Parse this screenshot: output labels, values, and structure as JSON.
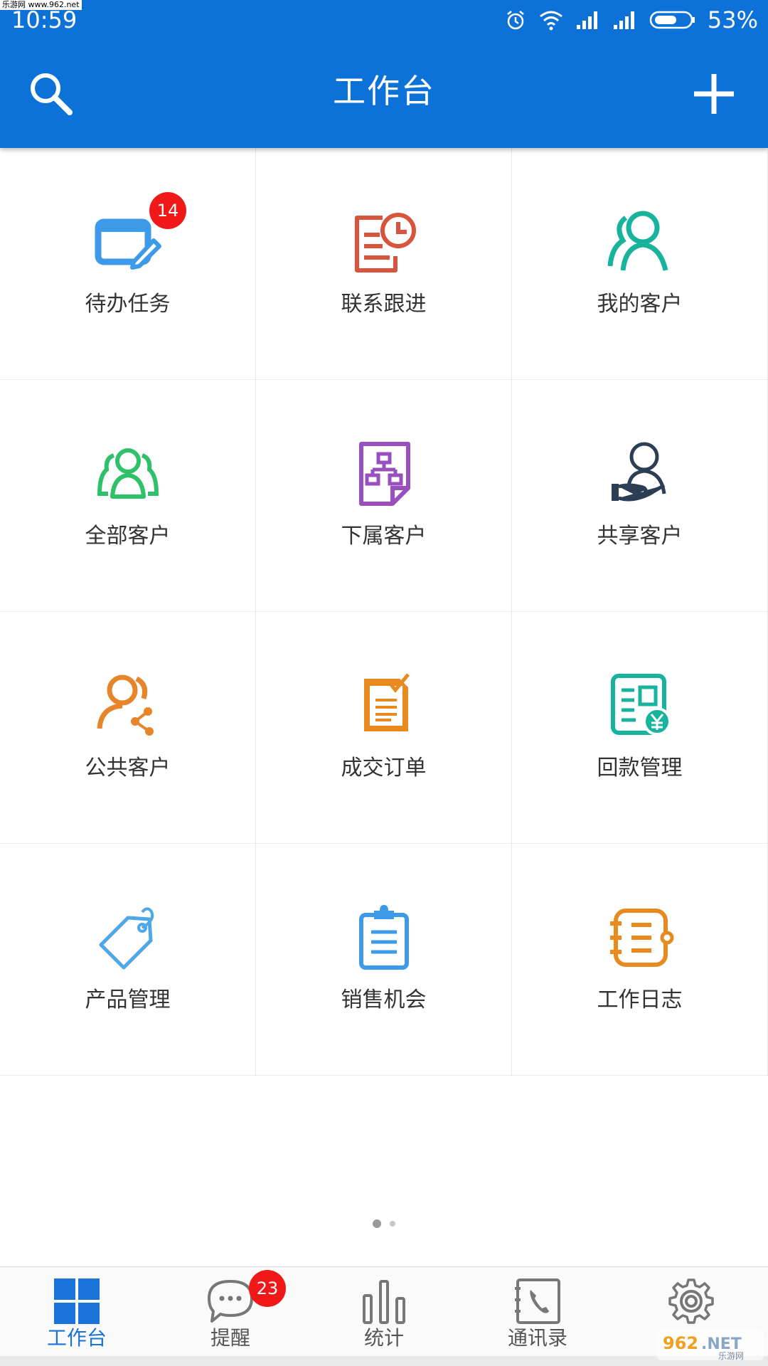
{
  "status_bar": {
    "watermark": "乐游网 www.962.net",
    "time": "10:59",
    "battery": "53%"
  },
  "header": {
    "title": "工作台"
  },
  "grid": [
    {
      "label": "待办任务",
      "badge": "14",
      "icon": "task-edit-icon",
      "color": "#3d9ae8"
    },
    {
      "label": "联系跟进",
      "icon": "followup-clock-icon",
      "color": "#d9543c"
    },
    {
      "label": "我的客户",
      "icon": "my-customer-icon",
      "color": "#17b39c"
    },
    {
      "label": "全部客户",
      "icon": "all-customers-icon",
      "color": "#2fc16a"
    },
    {
      "label": "下属客户",
      "icon": "subordinate-customers-icon",
      "color": "#9a4fbf"
    },
    {
      "label": "共享客户",
      "icon": "shared-customer-icon",
      "color": "#2c3e55"
    },
    {
      "label": "公共客户",
      "icon": "public-customers-icon",
      "color": "#e6852a"
    },
    {
      "label": "成交订单",
      "icon": "order-icon",
      "color": "#e88a1e"
    },
    {
      "label": "回款管理",
      "icon": "payment-icon",
      "color": "#17b39c"
    },
    {
      "label": "产品管理",
      "icon": "product-tag-icon",
      "color": "#4ea7e6"
    },
    {
      "label": "销售机会",
      "icon": "clipboard-icon",
      "color": "#3d9ae8"
    },
    {
      "label": "工作日志",
      "icon": "worklog-icon",
      "color": "#e88a1e"
    }
  ],
  "pager": {
    "pages": 2,
    "current": 1
  },
  "tabs": [
    {
      "label": "工作台",
      "icon": "workbench-grid-icon",
      "active": true
    },
    {
      "label": "提醒",
      "icon": "chat-bubble-icon",
      "badge": "23"
    },
    {
      "label": "统计",
      "icon": "bar-chart-icon"
    },
    {
      "label": "通讯录",
      "icon": "contacts-phone-icon"
    },
    {
      "label": "",
      "icon": "settings-gear-icon"
    }
  ],
  "colors": {
    "primary": "#0d72d8",
    "badge": "#f01818",
    "tab_active": "#1a73d9"
  },
  "watermark_logo": "962.NET 乐游网"
}
